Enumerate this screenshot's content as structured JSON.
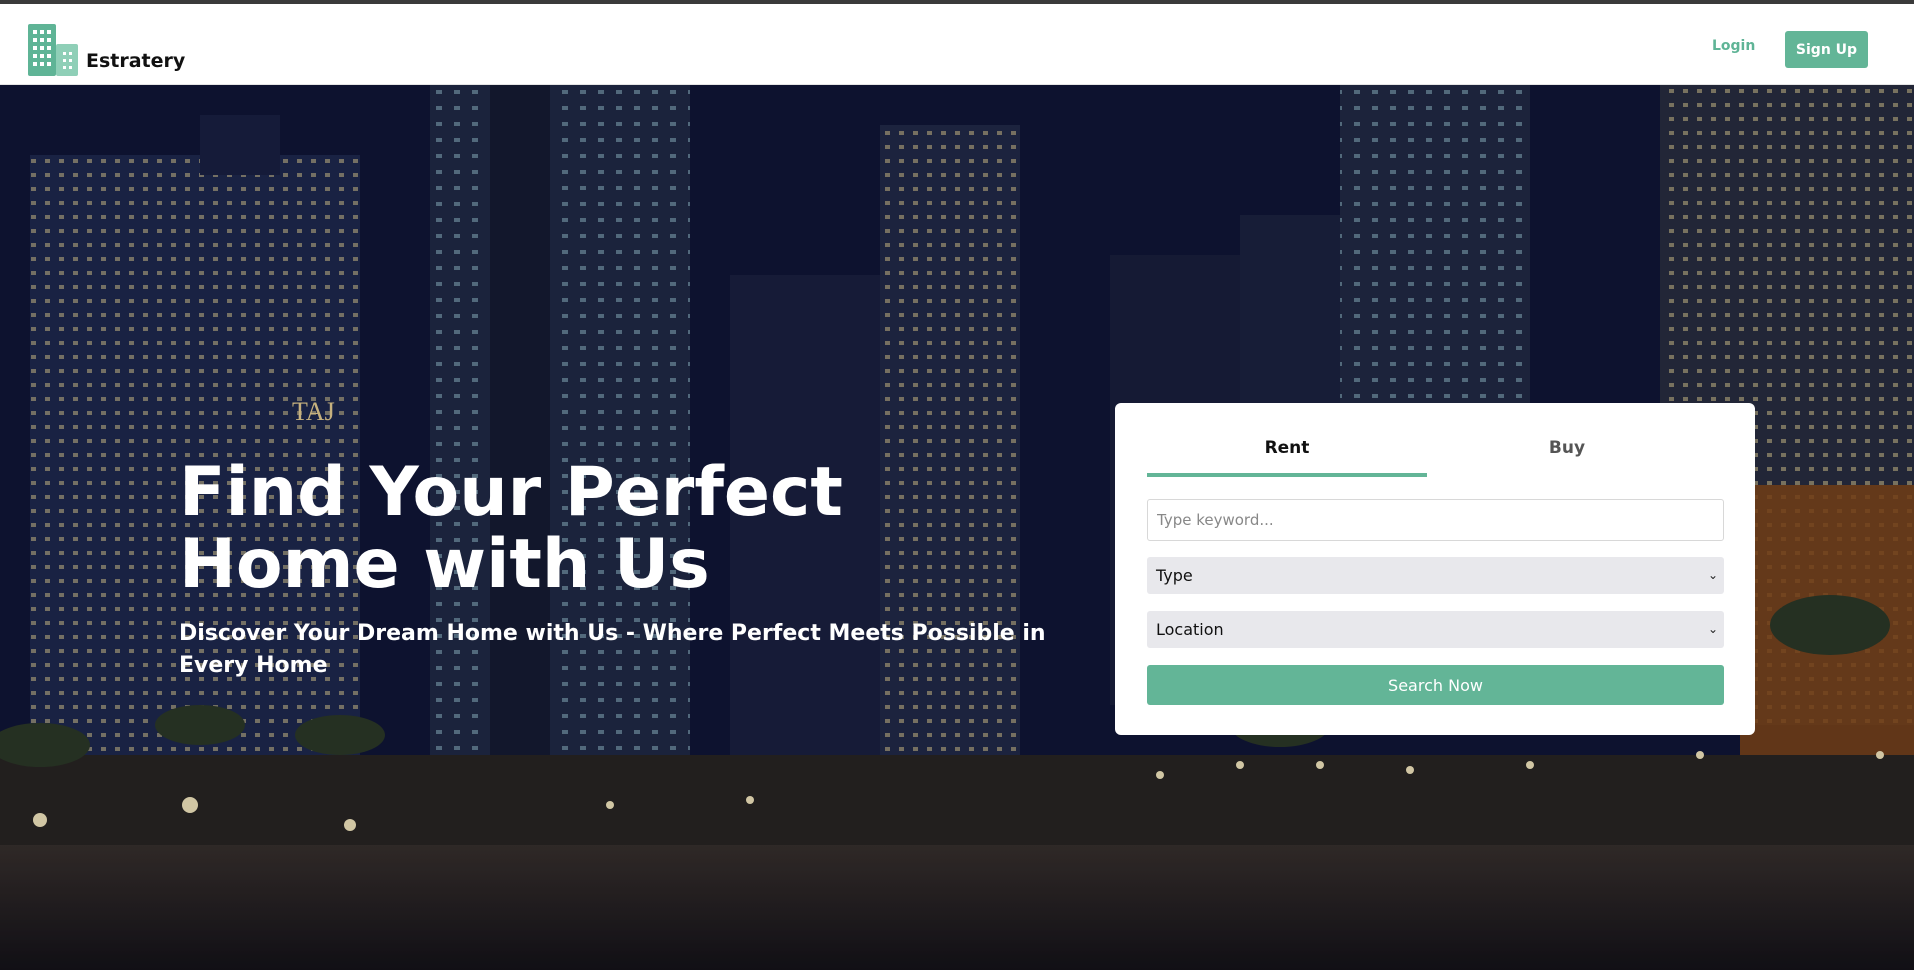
{
  "header": {
    "logo_text": "Estratery",
    "login_label": "Login",
    "signup_label": "Sign Up"
  },
  "hero": {
    "title": "Find Your Perfect Home with Us",
    "subtitle": "Discover Your Dream Home with Us - Where Perfect Meets Possible in Every Home",
    "sign_text": "TAJ"
  },
  "search": {
    "tabs": [
      {
        "label": "Rent",
        "active": true
      },
      {
        "label": "Buy",
        "active": false
      }
    ],
    "keyword_placeholder": "Type keyword...",
    "type_value": "Type",
    "location_value": "Location",
    "submit_label": "Search Now"
  },
  "colors": {
    "accent": "#63b597",
    "header_bg": "#ffffff",
    "card_bg": "#ffffff"
  },
  "icons": {
    "logo": "building-icon",
    "select_arrow": "chevron-down-icon"
  }
}
